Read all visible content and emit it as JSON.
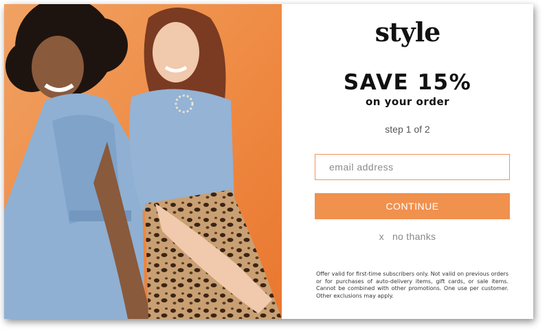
{
  "brand": {
    "logo_text": "style"
  },
  "offer": {
    "headline": "SAVE 15%",
    "subhead": "on your order",
    "step": "step 1 of 2"
  },
  "form": {
    "email_placeholder": "email address",
    "email_value": "",
    "continue_label": "CONTINUE",
    "dismiss_icon": "x",
    "dismiss_label": "no thanks"
  },
  "legal": {
    "fine_print": "Offer valid for first-time subscribers only. Not valid on previous orders or for purchases of auto-delivery items, gift cards, or sale items. Cannot be combined with other promotions. One use per customer. Other exclusions may apply."
  },
  "colors": {
    "accent": "#f0914e",
    "input_border": "#f0935a",
    "hero_background": "#ef8c45"
  }
}
